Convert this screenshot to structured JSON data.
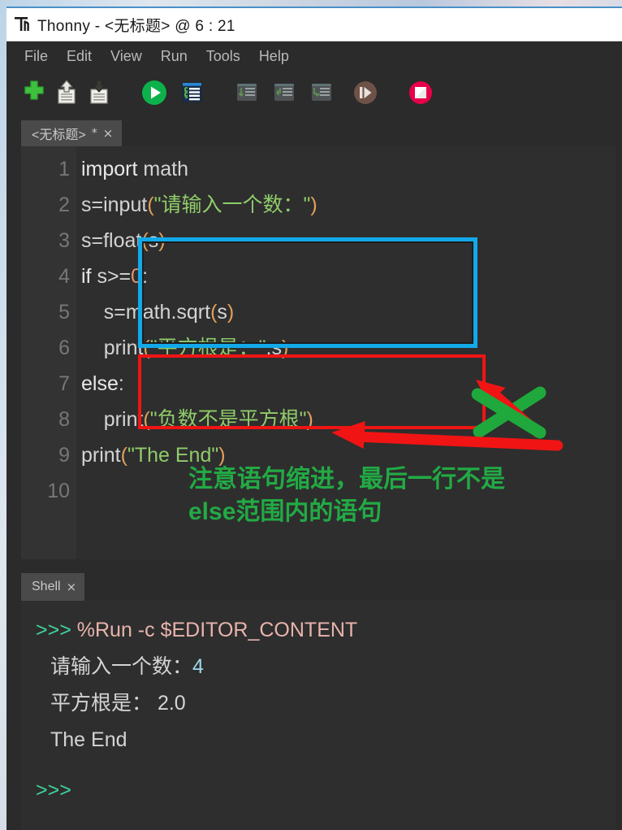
{
  "window": {
    "title": "Thonny  -  <无标题>  @  6 : 21",
    "app_icon": "thonny-logo-icon"
  },
  "menubar": {
    "items": [
      {
        "label": "File",
        "name": "menu-file"
      },
      {
        "label": "Edit",
        "name": "menu-edit"
      },
      {
        "label": "View",
        "name": "menu-view"
      },
      {
        "label": "Run",
        "name": "menu-run"
      },
      {
        "label": "Tools",
        "name": "menu-tools"
      },
      {
        "label": "Help",
        "name": "menu-help"
      }
    ]
  },
  "toolbar": {
    "buttons": [
      {
        "name": "new-file-button",
        "icon": "plus-icon",
        "tooltip": "New",
        "enabled": true
      },
      {
        "name": "open-file-button",
        "icon": "open-folder-icon",
        "tooltip": "Load",
        "enabled": true
      },
      {
        "name": "save-file-button",
        "icon": "save-disk-icon",
        "tooltip": "Save",
        "enabled": true
      },
      {
        "name": "run-button",
        "icon": "play-icon",
        "tooltip": "Run",
        "enabled": true
      },
      {
        "name": "debug-button",
        "icon": "debug-icon",
        "tooltip": "Debug",
        "enabled": true
      },
      {
        "name": "step-over-button",
        "icon": "step-over-icon",
        "tooltip": "Step over",
        "enabled": false
      },
      {
        "name": "step-into-button",
        "icon": "step-into-icon",
        "tooltip": "Step into",
        "enabled": false
      },
      {
        "name": "step-out-button",
        "icon": "step-out-icon",
        "tooltip": "Step out",
        "enabled": false
      },
      {
        "name": "resume-button",
        "icon": "resume-icon",
        "tooltip": "Resume",
        "enabled": false
      },
      {
        "name": "stop-button",
        "icon": "stop-icon",
        "tooltip": "Stop",
        "enabled": true
      }
    ]
  },
  "editor": {
    "tab": {
      "label": "<无标题>",
      "dirty_marker": "*",
      "close_glyph": "×"
    },
    "line_numbers": [
      "1",
      "2",
      "3",
      "4",
      "5",
      "6",
      "7",
      "8",
      "9",
      "10"
    ],
    "lines": [
      {
        "n": "1",
        "text": "import math"
      },
      {
        "n": "2",
        "text": "s=input(\"请输入一个数：\")"
      },
      {
        "n": "3",
        "text": "s=float(s)"
      },
      {
        "n": "4",
        "text": "if s>=0:"
      },
      {
        "n": "5",
        "text": "    s=math.sqrt(s)"
      },
      {
        "n": "6",
        "text": "    print(\"平方根是：\",s)"
      },
      {
        "n": "7",
        "text": "else:"
      },
      {
        "n": "8",
        "text": "    print(\"负数不是平方根\")"
      },
      {
        "n": "9",
        "text": "print(\"The End\")"
      },
      {
        "n": "10",
        "text": ""
      }
    ],
    "tokens": {
      "l1_kw": "import",
      "l1_rest": " math",
      "l2_a": "s=input",
      "l2_p1": "(",
      "l2_str": "\"请输入一个数：\"",
      "l2_p2": ")",
      "l3_a": "s=float",
      "l3_p1": "(",
      "l3_name": "s",
      "l3_p2": ")",
      "l4_kw": "if",
      "l4_expr": " s>=",
      "l4_num": "0",
      "l4_colon": ":",
      "l5_a": "    s=math.sqrt",
      "l5_p1": "(",
      "l5_name": "s",
      "l5_p2": ")",
      "l6_a": "    print",
      "l6_p1": "(",
      "l6_str": "\"平方根是：\"",
      "l6_comma": ",s",
      "l6_p2": ")",
      "l7_kw": "else",
      "l7_colon": ":",
      "l8_a": "    print",
      "l8_p1": "(",
      "l8_str": "\"负数不是平方根\"",
      "l8_p2": ")",
      "l9_a": "print",
      "l9_p1": "(",
      "l9_str": "\"The End\"",
      "l9_p2": ")"
    },
    "annotations": {
      "blue_box_label": "if-branch-highlight",
      "red_box_label": "else-branch-highlight",
      "note_line1": "注意语句缩进，最后一行不是",
      "note_line2": "else范围内的语句",
      "note_color": "#22aa44",
      "blue_color": "#12a9e8",
      "red_color": "#f01414",
      "green_color": "#1fa83c"
    }
  },
  "shell": {
    "tab": {
      "label": "Shell",
      "close_glyph": "×"
    },
    "lines": [
      {
        "prompt": ">>>",
        "command": " %Run -c $EDITOR_CONTENT"
      },
      {
        "output": "请输入一个数：",
        "input": "4"
      },
      {
        "output": "平方根是： 2.0"
      },
      {
        "output": "The End"
      },
      {
        "prompt": ">>>"
      }
    ],
    "prompt_color": "#3dd49a",
    "command_color": "#e8b4ad",
    "input_color": "#9dd8e8"
  }
}
